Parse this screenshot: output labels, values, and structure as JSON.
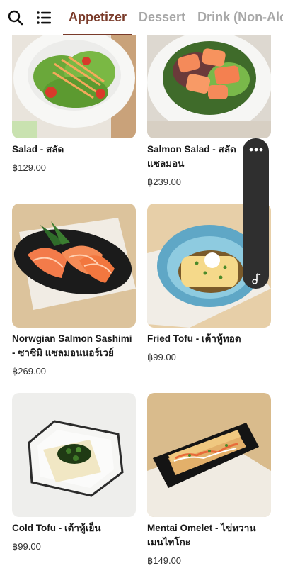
{
  "header": {
    "tabs": [
      {
        "label": "Appetizer",
        "active": true
      },
      {
        "label": "Dessert",
        "active": false
      },
      {
        "label": "Drink (Non-Alc",
        "active": false
      }
    ]
  },
  "items": [
    {
      "name": "Salad - สลัด",
      "price": "฿129.00"
    },
    {
      "name": "Salmon Salad - สลัดแซลมอน",
      "price": "฿239.00"
    },
    {
      "name": "Norwgian Salmon Sashimi - ซาซิมิ แซลมอนนอร์เวย์",
      "price": "฿269.00"
    },
    {
      "name": "Fried Tofu - เต้าหู้ทอด",
      "price": "฿99.00"
    },
    {
      "name": "Cold Tofu - เต้าหู้เย็น",
      "price": "฿99.00"
    },
    {
      "name": "Mentai Omelet - ไข่หวานเมนไทโกะ",
      "price": "฿149.00"
    }
  ],
  "colors": {
    "accent": "#7a3b2a",
    "inactive_tab": "#a7a7a7"
  },
  "icons": {
    "search": "search-icon",
    "menu": "list-menu-icon",
    "more": "more-dots-icon",
    "music": "music-note-icon"
  }
}
